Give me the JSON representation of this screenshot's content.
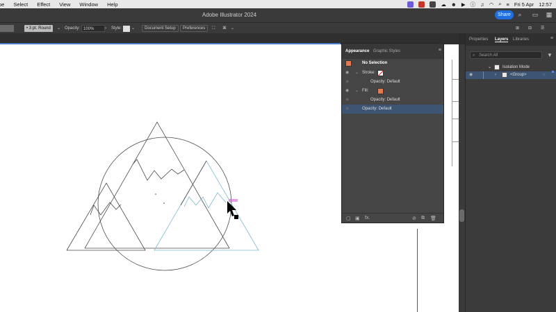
{
  "menubar": {
    "items": [
      "pe",
      "Select",
      "Effect",
      "View",
      "Window",
      "Help"
    ],
    "date": "Fri 5 Apr",
    "time": "12:57"
  },
  "titlebar": {
    "title": "Adobe Illustrator 2024",
    "share_label": "Share"
  },
  "controlbar": {
    "stroke_profile": "3 pt. Round",
    "opacity_label": "Opacity:",
    "opacity_value": "100%",
    "style_label": "Style:",
    "document_setup": "Document Setup",
    "preferences": "Preferences"
  },
  "appearance": {
    "tabs": [
      "Appearance",
      "Graphic Styles"
    ],
    "selection": "No Selection",
    "stroke_label": "Stroke:",
    "stroke_opacity": "Opacity:",
    "stroke_opacity_value": "Default",
    "fill_label": "Fill:",
    "fill_opacity": "Opacity:",
    "fill_opacity_value": "Default",
    "opacity": "Opacity:",
    "opacity_value": "Default",
    "fill_color": "#e07a52"
  },
  "dock": {
    "tabs": [
      "Properties",
      "Layers",
      "Libraries"
    ],
    "search_placeholder": "Search All",
    "layers": [
      "Isolation Mode",
      "<Group>"
    ]
  },
  "colors": {
    "accent": "#1f6fe0",
    "selection": "#3d5573",
    "guide": "#7fb8cc",
    "smart_guide": "#e05ae0"
  }
}
